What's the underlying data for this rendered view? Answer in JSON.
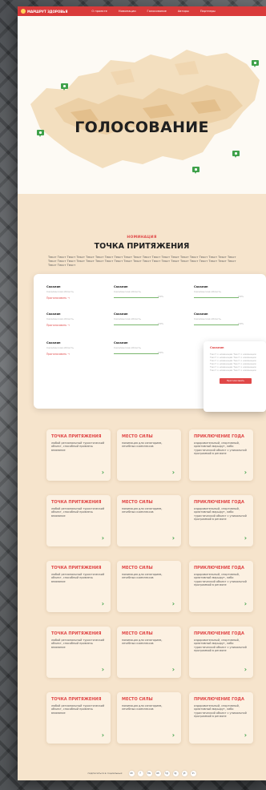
{
  "header": {
    "logo": "МАРШРУТ ЗДОРОВЬЯ",
    "nav": [
      "О проекте",
      "Номинации",
      "Голосование",
      "Авторы",
      "Партнеры"
    ]
  },
  "hero": {
    "title": "ГОЛОСОВАНИЕ"
  },
  "nomination": {
    "label": "НОМИНАЦИЯ",
    "title": "ТОЧКА ПРИТЯЖЕНИЯ",
    "text": "Текст Текст Текст Текст Текст Текст Текст Текст Текст Текст Текст Текст Текст Текст Текст Текст Текст Текст Текст Текст Текст Текст Текст Текст Текст Текст Текст Текст Текст Текст Текст Текст Текст Текст Текст Текст Текст Текст Текст Текст Текст Текст Текст"
  },
  "vote": {
    "items": [
      {
        "name": "Сахалин",
        "sub": "Сахалинская область",
        "link": "Проголосовать →"
      },
      {
        "name": "Сахалин",
        "sub": "Сахалинская область",
        "pct": "100%"
      },
      {
        "name": "Сахалин",
        "sub": "Сахалинская область",
        "pct": "100%"
      },
      {
        "name": "Сахалин",
        "sub": "Сахалинская область",
        "link": "Проголосовать →"
      },
      {
        "name": "Сахалин",
        "sub": "Сахалинская область",
        "pct": "100%"
      },
      {
        "name": "Сахалин",
        "sub": "Сахалинская область",
        "pct": "100%"
      },
      {
        "name": "Сахалин",
        "sub": "Сахалинская область",
        "link": "Проголосовать →"
      },
      {
        "name": "Сахалин",
        "sub": "Сахалинская область",
        "pct": "100%"
      }
    ],
    "popup": {
      "name": "Сахалин",
      "text": "Текст о номинации Текст о номинации Текст о номинации Текст о номинации Текст о номинации Текст о номинации Текст о номинации Текст о номинации Текст о номинации Текст о номинации Текст о номинации Текст о номинации",
      "button": "Проголосовать"
    }
  },
  "cards": [
    {
      "title": "ТОЧКА ПРИТЯЖЕНИЯ",
      "text": "любой региональный туристический объект, способный привлечь внимание"
    },
    {
      "title": "МЕСТО СИЛЫ",
      "text": "номинация для санаториев, лечебных комплексов"
    },
    {
      "title": "ПРИКЛЮЧЕНИЕ ГОДА",
      "text": "оздоровительный, спортивный, креативный маршрут, либо туристический объект с уникальной программой в регионе"
    }
  ],
  "footer": {
    "text": "подписаться в социальных",
    "socials": [
      "vk",
      "f",
      "tw",
      "ok",
      "tg",
      "ig",
      "yt",
      "in"
    ]
  }
}
